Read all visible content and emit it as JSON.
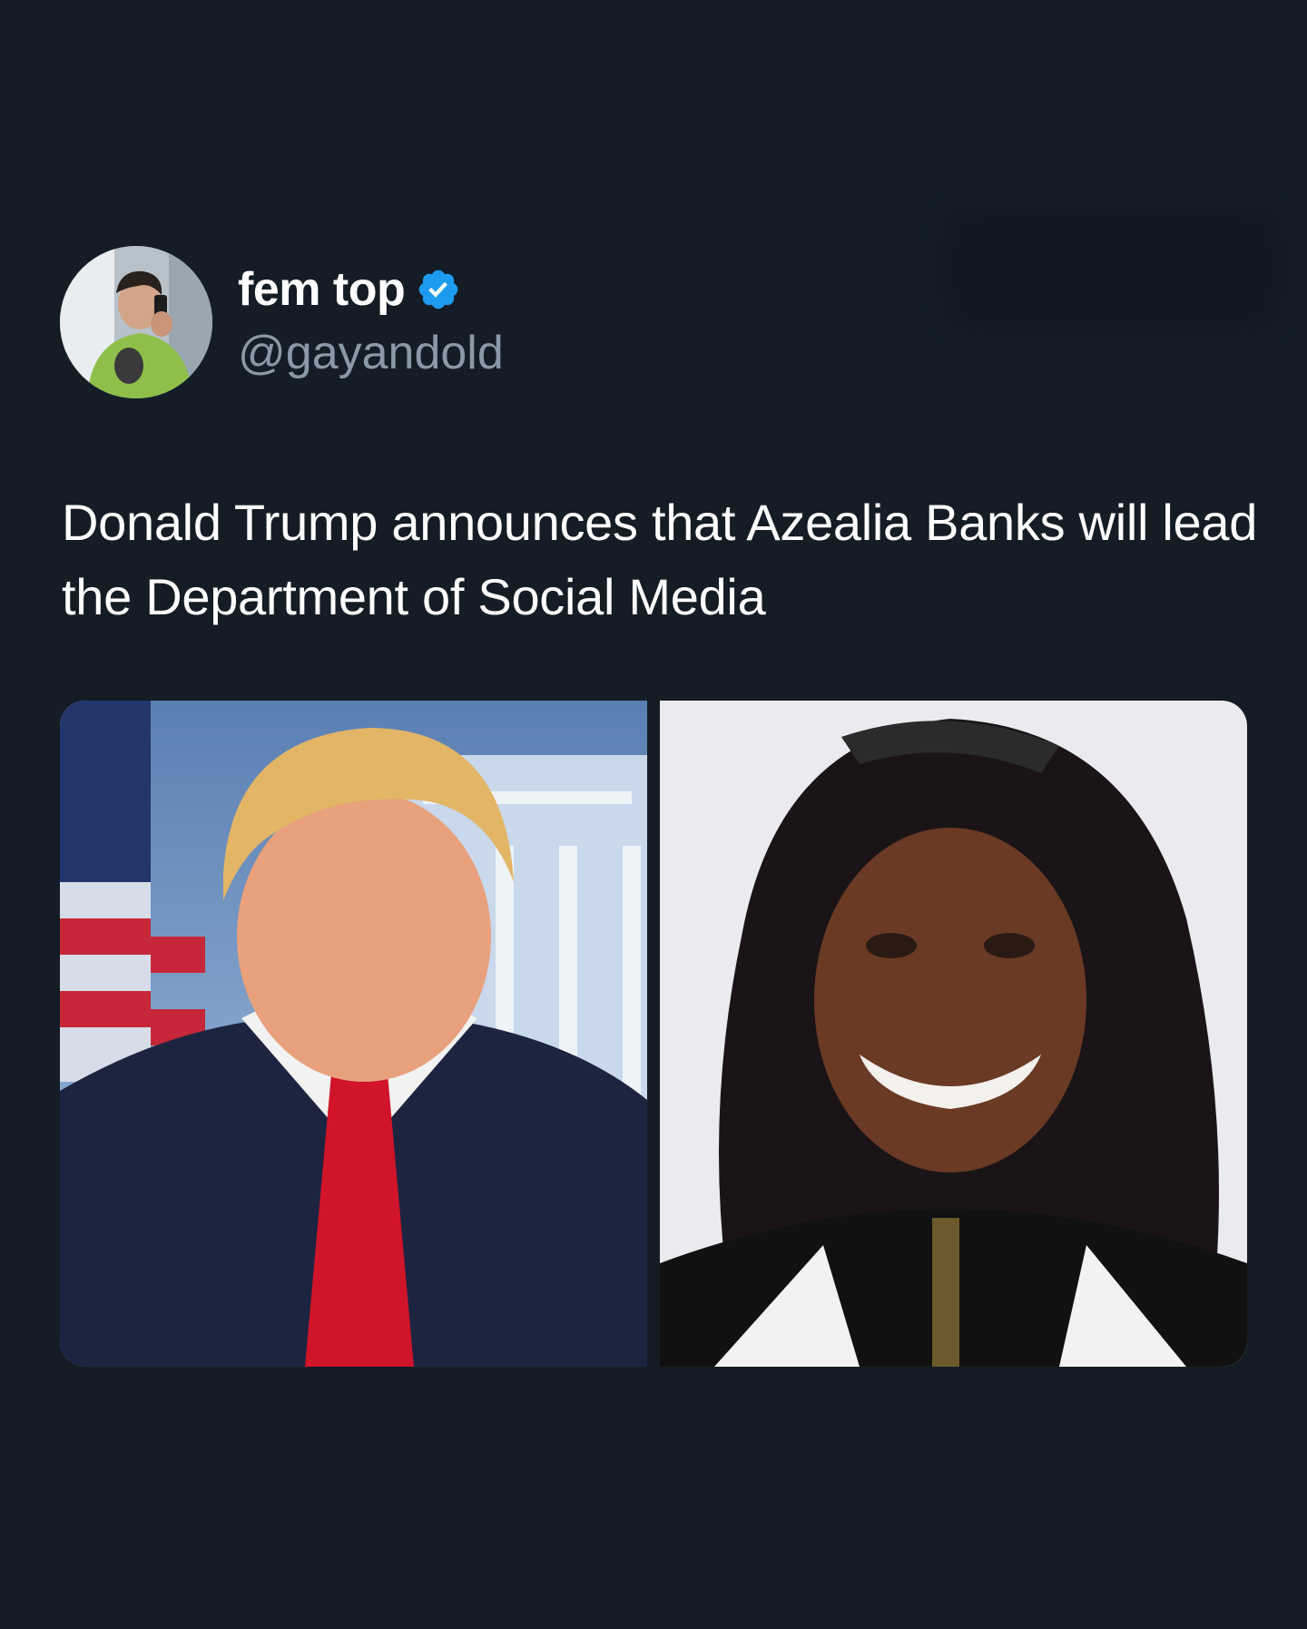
{
  "tweet": {
    "author": {
      "display_name": "fem top",
      "handle": "@gayandold",
      "verified": true,
      "verified_icon": "verified-badge-icon",
      "verified_color": "#1d9bf0"
    },
    "text": "Donald Trump announces that Azealia Banks will lead the Department of Social Media",
    "media": [
      {
        "name": "media-photo-trump"
      },
      {
        "name": "media-photo-azealia-banks"
      }
    ]
  },
  "colors": {
    "background": "#141d26",
    "text_primary": "#ffffff",
    "text_secondary": "#8b98a5",
    "accent": "#1d9bf0"
  }
}
